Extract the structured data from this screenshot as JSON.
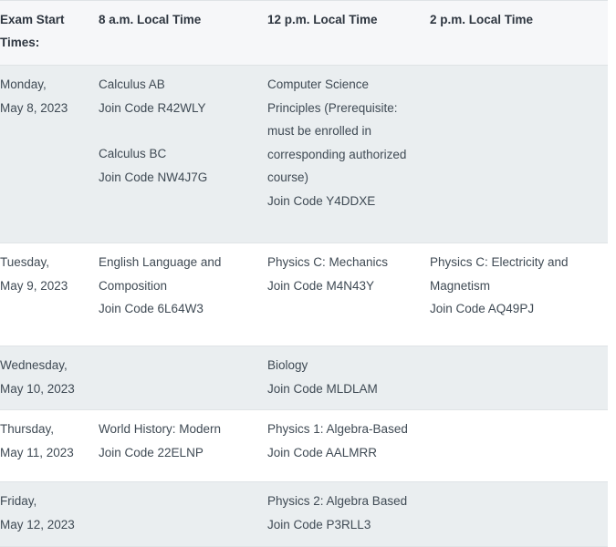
{
  "table": {
    "columns": [
      {
        "id": "exam-start-times",
        "label": "Exam Start Times:"
      },
      {
        "id": "8am",
        "label": "8 a.m. Local Time"
      },
      {
        "id": "12pm",
        "label": "12 p.m. Local Time"
      },
      {
        "id": "2pm",
        "label": "2 p.m. Local Time"
      }
    ],
    "rows": [
      {
        "id": "monday",
        "shaded": true,
        "date_day": "Monday,",
        "date_full": "May 8, 2023",
        "slot_8am": {
          "exam_1_name": "Calculus AB",
          "exam_1_code": "Join Code R42WLY",
          "exam_2_name": "Calculus BC",
          "exam_2_code": "Join Code NW4J7G"
        },
        "slot_12pm": {
          "exam_1_name": "Computer Science Principles (Prerequisite: must be enrolled in corresponding authorized course)",
          "exam_1_code": "Join Code Y4DDXE"
        },
        "slot_2pm": {}
      },
      {
        "id": "tuesday",
        "shaded": false,
        "date_day": "Tuesday,",
        "date_full": "May 9, 2023",
        "slot_8am": {
          "exam_1_name": "English Language and Composition",
          "exam_1_code": "Join Code 6L64W3"
        },
        "slot_12pm": {
          "exam_1_name": "Physics C: Mechanics",
          "exam_1_code": "Join Code M4N43Y"
        },
        "slot_2pm": {
          "exam_1_name": "Physics C: Electricity and Magnetism",
          "exam_1_code": "Join Code AQ49PJ"
        }
      },
      {
        "id": "wednesday",
        "shaded": true,
        "date_day": "Wednesday,",
        "date_full": "May 10, 2023",
        "slot_8am": {},
        "slot_12pm": {
          "exam_1_name": "Biology",
          "exam_1_code": "Join Code MLDLAM"
        },
        "slot_2pm": {}
      },
      {
        "id": "thursday",
        "shaded": false,
        "date_day": "Thursday,",
        "date_full": "May 11, 2023",
        "slot_8am": {
          "exam_1_name": "World History: Modern",
          "exam_1_code": "Join Code 22ELNP"
        },
        "slot_12pm": {
          "exam_1_name": "Physics 1: Algebra-Based",
          "exam_1_code": "Join Code AALMRR"
        },
        "slot_2pm": {}
      },
      {
        "id": "friday",
        "shaded": true,
        "date_day": "Friday,",
        "date_full": "May 12, 2023",
        "slot_8am": {},
        "slot_12pm": {
          "exam_1_name": "Physics 2: Algebra Based",
          "exam_1_code": "Join Code P3RLL3"
        },
        "slot_2pm": {}
      }
    ]
  },
  "colors": {
    "page_background": "#ffffff",
    "header_background": "#f6f7f9",
    "row_shaded_background": "#eaeef0",
    "row_plain_background": "#ffffff",
    "border": "#dfe3e6",
    "header_text": "#2e3640",
    "body_text": "#3f4a54"
  }
}
